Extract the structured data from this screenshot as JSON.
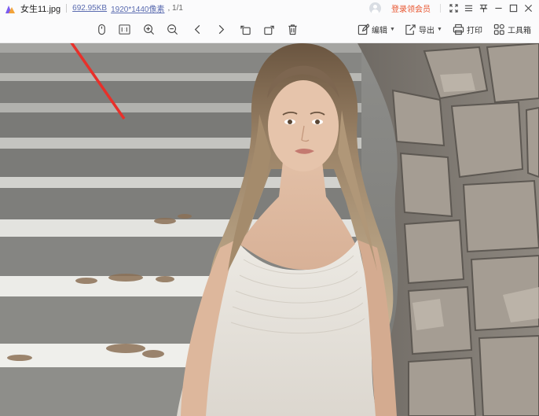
{
  "titlebar": {
    "filename": "女生11.jpg",
    "file_size": "692.95KB",
    "dimensions": "1920*1440像素",
    "page_index": ", 1/1",
    "member_link": "登录领会员"
  },
  "toolbar": {
    "edit_label": "编辑",
    "export_label": "导出",
    "print_label": "打印",
    "toolbox_label": "工具箱"
  },
  "photo": {
    "subject": "photo of a woman in white dress by stone wall and stairs"
  },
  "colors": {
    "accent": "#e8542e",
    "meta_link": "#5b6cb0",
    "arrow": "#e8302a"
  }
}
